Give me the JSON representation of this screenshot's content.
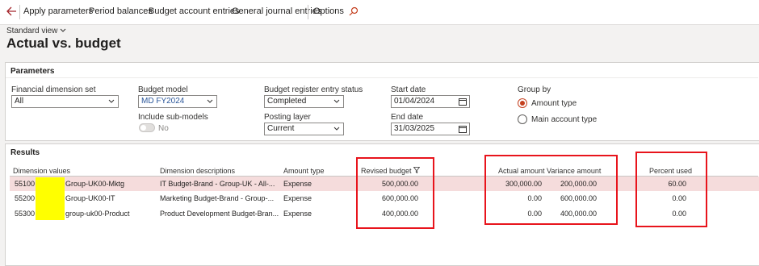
{
  "toolbar": {
    "items": [
      "Apply parameters",
      "Period balances",
      "Budget account entries",
      "General journal entries",
      "Options"
    ]
  },
  "header": {
    "view_label": "Standard view",
    "title": "Actual vs. budget"
  },
  "parameters": {
    "heading": "Parameters",
    "financial_dimension_set": {
      "label": "Financial dimension set",
      "value": "All"
    },
    "budget_model": {
      "label": "Budget model",
      "value": "MD FY2024"
    },
    "include_sub_models": {
      "label": "Include sub-models",
      "value": "No"
    },
    "budget_register_status": {
      "label": "Budget register entry status",
      "value": "Completed"
    },
    "posting_layer": {
      "label": "Posting layer",
      "value": "Current"
    },
    "start_date": {
      "label": "Start date",
      "value": "01/04/2024"
    },
    "end_date": {
      "label": "End date",
      "value": "31/03/2025"
    },
    "group_by": {
      "label": "Group by",
      "options": [
        "Amount type",
        "Main account type"
      ],
      "selected": "Amount type"
    }
  },
  "results": {
    "heading": "Results",
    "columns": {
      "dimension_values": "Dimension values",
      "dimension_descriptions": "Dimension descriptions",
      "amount_type": "Amount type",
      "revised_budget": "Revised budget",
      "actual_amount": "Actual amount",
      "variance_amount": "Variance amount",
      "percent_used": "Percent used"
    },
    "rows": [
      {
        "code": "55100",
        "group": "Group-UK00-Mktg",
        "description": "IT Budget-Brand - Group-UK - All-...",
        "amount_type": "Expense",
        "revised_budget": "500,000.00",
        "actual_amount": "300,000.00",
        "variance_amount": "200,000.00",
        "percent_used": "60.00"
      },
      {
        "code": "55200",
        "group": "Group-UK00-IT",
        "description": "Marketing Budget-Brand - Group-...",
        "amount_type": "Expense",
        "revised_budget": "600,000.00",
        "actual_amount": "0.00",
        "variance_amount": "600,000.00",
        "percent_used": "0.00"
      },
      {
        "code": "55300",
        "group": "group-uk00-Product",
        "description": "Product Development Budget-Bran...",
        "amount_type": "Expense",
        "revised_budget": "400,000.00",
        "actual_amount": "0.00",
        "variance_amount": "400,000.00",
        "percent_used": "0.00"
      }
    ]
  },
  "colors": {
    "accent": "#c43f1e",
    "highlight_row": "#f5dcdc",
    "annotation_box": "#e8141c",
    "redaction": "#ffff00"
  },
  "icons": [
    "back-arrow-icon",
    "search-icon",
    "chevron-down-icon",
    "calendar-icon",
    "filter-icon"
  ]
}
